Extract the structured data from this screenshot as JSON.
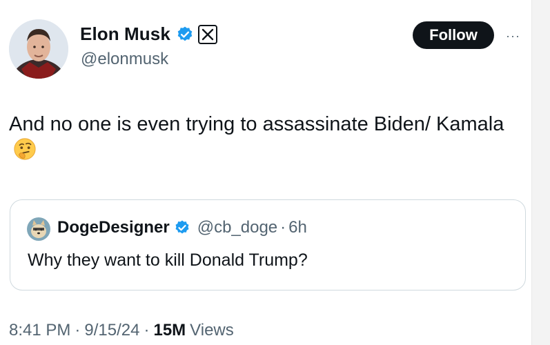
{
  "author": {
    "name": "Elon Musk",
    "handle": "@elonmusk",
    "verified_color": "#1d9bf0"
  },
  "actions": {
    "follow_label": "Follow",
    "more_label": "···"
  },
  "tweet": {
    "text": "And no one is even trying to assassinate Biden/ Kamala",
    "emoji": "thinking-face"
  },
  "quoted": {
    "name": "DogeDesigner",
    "handle": "@cb_doge",
    "dot": "·",
    "time": "6h",
    "text": "Why they want to kill Donald Trump?"
  },
  "meta": {
    "time": "8:41 PM",
    "sep1": "·",
    "date": "9/15/24",
    "sep2": "·",
    "views_count": "15M",
    "views_label": "Views"
  }
}
